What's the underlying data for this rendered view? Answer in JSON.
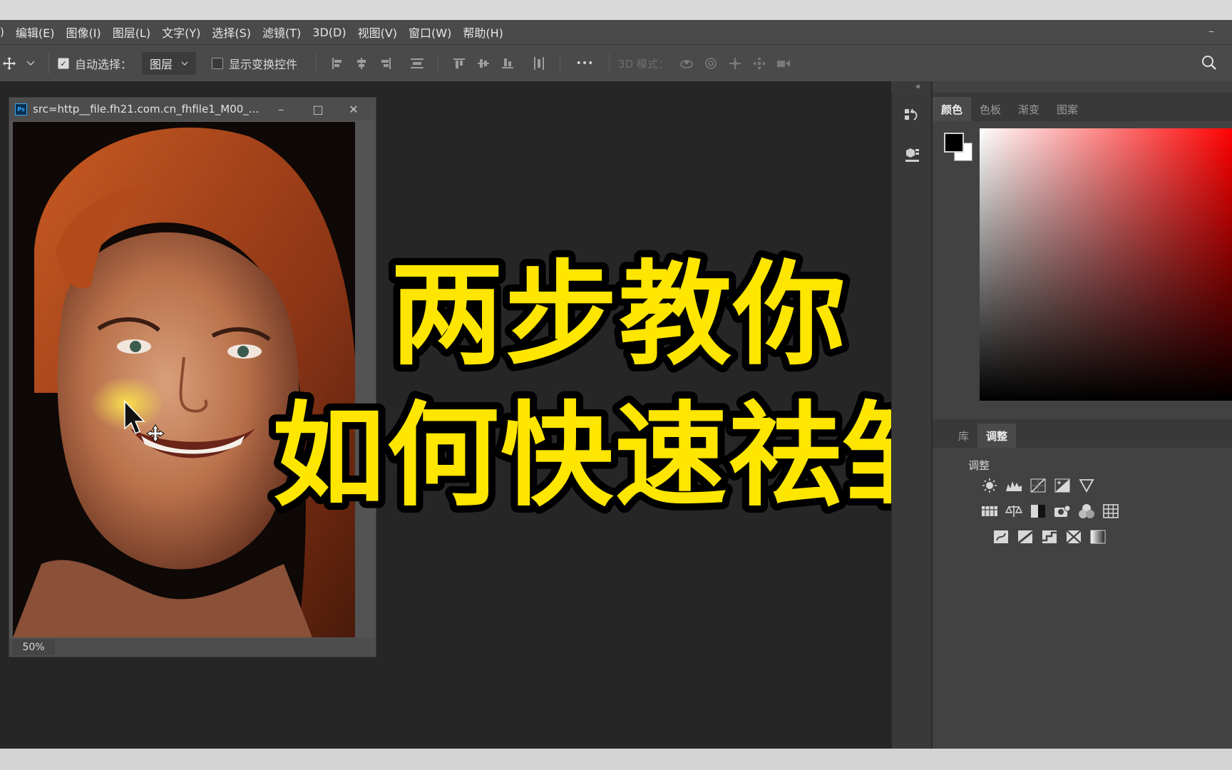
{
  "menubar": {
    "leading_fragment": ")",
    "items": [
      "编辑(E)",
      "图像(I)",
      "图层(L)",
      "文字(Y)",
      "选择(S)",
      "滤镜(T)",
      "3D(D)",
      "视图(V)",
      "窗口(W)",
      "帮助(H)"
    ],
    "minimize": "–"
  },
  "options": {
    "move_icon": "move-tool-icon",
    "auto_select_label": "自动选择：",
    "auto_select_checked": true,
    "layer_select_value": "图层",
    "show_transform_label": "显示变换控件",
    "show_transform_checked": false,
    "more": "•••",
    "mode_3d_label": "3D 模式："
  },
  "document": {
    "title": "src=http__file.fh21.com.cn_fhfile1_M00_...",
    "zoom": "50%",
    "controls": {
      "minimize": "–",
      "maximize": "□",
      "close": "✕"
    }
  },
  "overlay": {
    "line1": "两步教你",
    "line2": "如何快速祛皱",
    "text_color": "#ffe600",
    "stroke_color": "#000000"
  },
  "color_panel": {
    "tabs": [
      "颜色",
      "色板",
      "渐变",
      "图案"
    ],
    "active_tab": "颜色",
    "foreground": "#000000",
    "background": "#ffffff",
    "hue": "#ff0000"
  },
  "adjust_panel": {
    "tabs": [
      "库",
      "调整"
    ],
    "active_tab": "调整",
    "section_label": "调整",
    "icons": [
      [
        "brightness-contrast-icon",
        "levels-icon",
        "curves-icon",
        "exposure-icon",
        "vibrance-icon"
      ],
      [
        "hue-saturation-icon",
        "color-balance-icon",
        "black-white-icon",
        "photo-filter-icon",
        "channel-mixer-icon",
        "color-lookup-icon"
      ],
      [
        "invert-icon",
        "posterize-icon",
        "threshold-icon",
        "selective-color-icon",
        "gradient-map-icon"
      ]
    ]
  },
  "colors": {
    "ui_dark": "#262626",
    "ui_bar": "#4a4a4a",
    "panel": "#424242",
    "ps_blue": "#31a8ff"
  }
}
